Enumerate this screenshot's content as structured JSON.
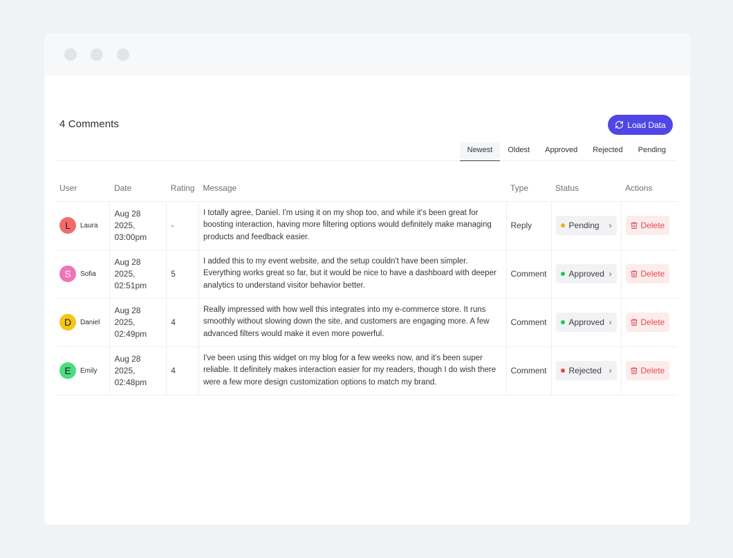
{
  "header": {
    "title": "4 Comments",
    "load_button": "Load Data"
  },
  "tabs": [
    {
      "label": "Newest",
      "active": true
    },
    {
      "label": "Oldest",
      "active": false
    },
    {
      "label": "Approved",
      "active": false
    },
    {
      "label": "Rejected",
      "active": false
    },
    {
      "label": "Pending",
      "active": false
    }
  ],
  "columns": [
    "User",
    "Date",
    "Rating",
    "Message",
    "Type",
    "Status",
    "Actions"
  ],
  "rows": [
    {
      "initial": "L",
      "name": "Laura",
      "avatar_color": "#f26b6b",
      "initial_color": "#1d1f24",
      "date_line1": "Aug 28 2025,",
      "date_line2": "03:00pm",
      "rating": "-",
      "message": "I totally agree, Daniel. I'm using it on my shop too, and while it's been great for boosting interaction, having more filtering options would definitely make managing products and feedback easier.",
      "type": "Reply",
      "status": "Pending",
      "status_color": "#eab308",
      "action": "Delete"
    },
    {
      "initial": "S",
      "name": "Sofia",
      "avatar_color": "#ef74b4",
      "initial_color": "#ffffff",
      "date_line1": "Aug 28 2025,",
      "date_line2": "02:51pm",
      "rating": "5",
      "message": "I added this to my event website, and the setup couldn't have been simpler. Everything works great so far, but it would be nice to have a dashboard with deeper analytics to understand visitor behavior better.",
      "type": "Comment",
      "status": "Approved",
      "status_color": "#22c55e",
      "action": "Delete"
    },
    {
      "initial": "D",
      "name": "Daniel",
      "avatar_color": "#f5c518",
      "initial_color": "#1d1f24",
      "date_line1": "Aug 28 2025,",
      "date_line2": "02:49pm",
      "rating": "4",
      "message": "Really impressed with how well this integrates into my e-commerce store. It runs smoothly without slowing down the site, and customers are engaging more. A few advanced filters would make it even more powerful.",
      "type": "Comment",
      "status": "Approved",
      "status_color": "#22c55e",
      "action": "Delete"
    },
    {
      "initial": "E",
      "name": "Emily",
      "avatar_color": "#4ade80",
      "initial_color": "#1d1f24",
      "date_line1": "Aug 28 2025,",
      "date_line2": "02:48pm",
      "rating": "4",
      "message": "I've been using this widget on my blog for a few weeks now, and it's been super reliable. It definitely makes interaction easier for my readers, though I do wish there were a few more design customization options to match my brand.",
      "type": "Comment",
      "status": "Rejected",
      "status_color": "#ef4444",
      "action": "Delete"
    }
  ],
  "colors": {
    "accent": "#4f46e5",
    "danger": "#e5484d",
    "danger_bg": "#fdecec"
  }
}
